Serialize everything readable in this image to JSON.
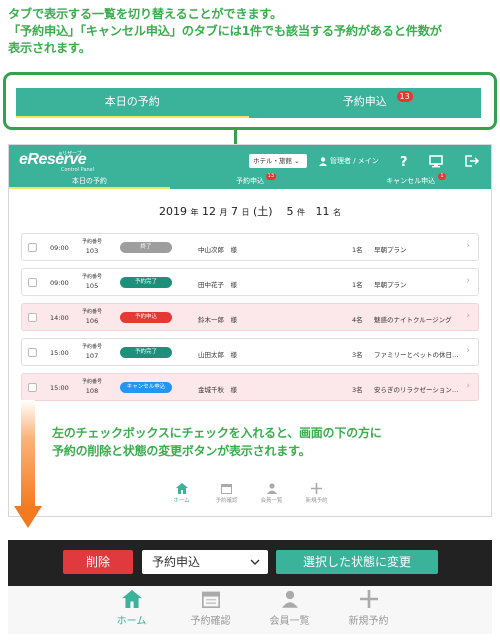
{
  "intro": {
    "line1": "タブで表示する一覧を切り替えることができます。",
    "line2": "「予約申込」「キャンセル申込」のタブには1件でも該当する予約があると件数が",
    "line3": "表示されます。"
  },
  "callout": {
    "tab_today": "本日の予約",
    "tab_apply": "予約申込",
    "apply_count": "13"
  },
  "app": {
    "logo": "eReserve",
    "logo_sub": "eリザーブ",
    "logo_cp": "Control Panel",
    "hotel_select": "ホテル・旅館",
    "user_label": "管理者 / メイン",
    "help_icon": "question-icon",
    "display_icon": "monitor-icon",
    "logout_icon": "logout-icon"
  },
  "tabs": [
    {
      "label": "本日の予約",
      "badge": ""
    },
    {
      "label": "予約申込",
      "badge": "13"
    },
    {
      "label": "キャンセル申込",
      "badge": "1"
    }
  ],
  "date": {
    "year": "2019",
    "year_unit": "年",
    "month": "12",
    "month_unit": "月",
    "day": "7",
    "day_unit": "日",
    "weekday": "(土)",
    "count": "5",
    "count_unit": "件",
    "people": "11",
    "people_unit": "名"
  },
  "reservation_label": "予約番号",
  "reservations": [
    {
      "time": "09:00",
      "no": "103",
      "status": "終了",
      "guest": "中山次郎　様",
      "people": "1名",
      "plan": "早朝プラン"
    },
    {
      "time": "09:00",
      "no": "105",
      "status": "予約完了",
      "guest": "田中花子　様",
      "people": "1名",
      "plan": "早朝プラン"
    },
    {
      "time": "14:00",
      "no": "106",
      "status": "予約申込",
      "guest": "鈴木一郎　様",
      "people": "4名",
      "plan": "魅惑のナイトクルージング"
    },
    {
      "time": "15:00",
      "no": "107",
      "status": "予約完了",
      "guest": "山田太郎　様",
      "people": "3名",
      "plan": "ファミリーとペットの休日…"
    },
    {
      "time": "15:00",
      "no": "108",
      "status": "キャンセル申込",
      "guest": "金城千秋　様",
      "people": "3名",
      "plan": "安らぎのリラクゼーション…"
    }
  ],
  "status_colors": {
    "終了": "#9e9e9e",
    "予約完了": "#1e8f7a",
    "予約申込": "#e53935",
    "キャンセル申込": "#2196f3"
  },
  "mini_nav": [
    "ホーム",
    "予約確認",
    "会員一覧",
    "新規予約"
  ],
  "mid_note": {
    "line1": "左のチェックボックスにチェックを入れると、画面の下の方に",
    "line2": "予約の削除と状態の変更ボタンが表示されます。"
  },
  "actions": {
    "delete": "削除",
    "status_value": "予約申込",
    "change": "選択した状態に変更"
  },
  "bottom_nav": [
    "ホーム",
    "予約確認",
    "会員一覧",
    "新規予約"
  ],
  "colors": {
    "accent": "#3ab39a",
    "note_green": "#3aae4e",
    "delete_red": "#e0393e",
    "arrow_orange": "#f47a1f"
  }
}
